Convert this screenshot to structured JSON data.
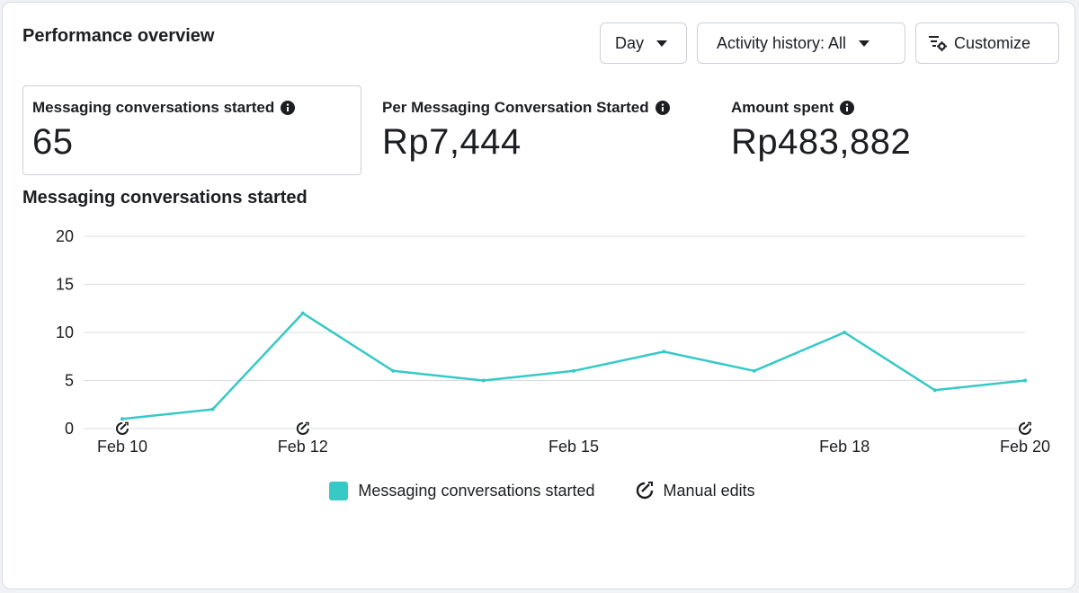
{
  "header": {
    "title": "Performance overview",
    "day_label": "Day",
    "activity_label": "Activity history: All",
    "customize_label": "Customize"
  },
  "metrics": [
    {
      "label": "Messaging conversations started",
      "value": "65"
    },
    {
      "label": "Per Messaging Conversation Started",
      "value": "Rp7,444"
    },
    {
      "label": "Amount spent",
      "value": "Rp483,882"
    }
  ],
  "icons": {
    "info": "info-icon",
    "caret": "caret-down-icon",
    "customize": "filter-gear-icon",
    "manual_edit": "manual-edit-icon"
  },
  "colors": {
    "series": "#36c9c6",
    "grid": "#dadde1",
    "text": "#1c1e21"
  },
  "chart_data": {
    "type": "line",
    "title": "Messaging conversations started",
    "x": [
      "Feb 10",
      "Feb 11",
      "Feb 12",
      "Feb 13",
      "Feb 14",
      "Feb 15",
      "Feb 16",
      "Feb 17",
      "Feb 18",
      "Feb 19",
      "Feb 20"
    ],
    "x_tick_labels": [
      "Feb 10",
      "Feb 12",
      "Feb 15",
      "Feb 18",
      "Feb 20"
    ],
    "series": [
      {
        "name": "Messaging conversations started",
        "values": [
          1,
          2,
          12,
          6,
          5,
          6,
          8,
          6,
          10,
          4,
          5
        ]
      }
    ],
    "y_ticks": [
      0,
      5,
      10,
      15,
      20
    ],
    "ylim": [
      0,
      20
    ],
    "grid": true,
    "manual_edits_at": [
      "Feb 10",
      "Feb 12",
      "Feb 20"
    ],
    "legend": {
      "position": "bottom-center",
      "items": [
        "Messaging conversations started",
        "Manual edits"
      ]
    }
  }
}
